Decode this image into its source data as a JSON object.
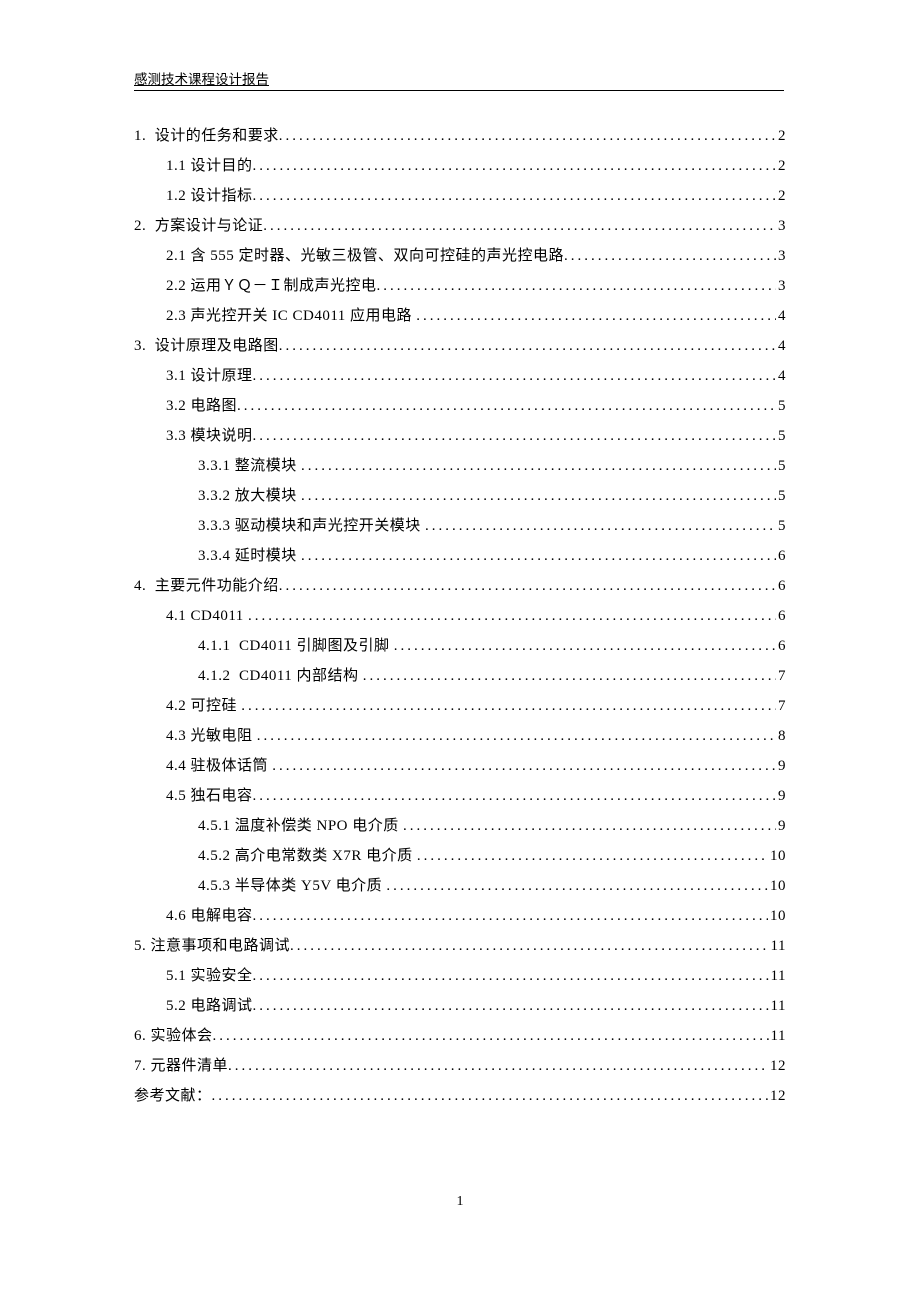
{
  "header": "感测技术课程设计报告",
  "footerPage": "1",
  "toc": [
    {
      "indent": 0,
      "label": "1.  设计的任务和要求",
      "page": "2"
    },
    {
      "indent": 1,
      "label": "1.1 设计目的",
      "page": "2"
    },
    {
      "indent": 1,
      "label": "1.2 设计指标",
      "page": "2"
    },
    {
      "indent": 0,
      "label": "2.  方案设计与论证",
      "page": "3"
    },
    {
      "indent": 1,
      "label": "2.1 含 555 定时器、光敏三极管、双向可控硅的声光控电路",
      "page": "3"
    },
    {
      "indent": 1,
      "label": "2.2 运用ＹＱ－Ｉ制成声光控电",
      "page": "3"
    },
    {
      "indent": 1,
      "label": "2.3 声光控开关 IC CD4011 应用电路 ",
      "page": "4"
    },
    {
      "indent": 0,
      "label": "3.  设计原理及电路图",
      "page": "4"
    },
    {
      "indent": 1,
      "label": "3.1 设计原理",
      "page": "4"
    },
    {
      "indent": 1,
      "label": "3.2 电路图",
      "page": "5"
    },
    {
      "indent": 1,
      "label": "3.3 模块说明",
      "page": "5"
    },
    {
      "indent": 2,
      "label": "3.3.1 整流模块 ",
      "page": "5"
    },
    {
      "indent": 2,
      "label": "3.3.2 放大模块 ",
      "page": "5"
    },
    {
      "indent": 2,
      "label": "3.3.3 驱动模块和声光控开关模块 ",
      "page": "5"
    },
    {
      "indent": 2,
      "label": "3.3.4 延时模块 ",
      "page": "6"
    },
    {
      "indent": 0,
      "label": "4.  主要元件功能介绍",
      "page": "6"
    },
    {
      "indent": 1,
      "label": "4.1 CD4011 ",
      "page": "6"
    },
    {
      "indent": 2,
      "label": "4.1.1  CD4011 引脚图及引脚 ",
      "page": "6"
    },
    {
      "indent": 2,
      "label": "4.1.2  CD4011 内部结构 ",
      "page": "7"
    },
    {
      "indent": 1,
      "label": "4.2 可控硅 ",
      "page": "7"
    },
    {
      "indent": 1,
      "label": "4.3 光敏电阻 ",
      "page": "8"
    },
    {
      "indent": 1,
      "label": "4.4 驻极体话筒 ",
      "page": "9"
    },
    {
      "indent": 1,
      "label": "4.5 独石电容",
      "page": "9"
    },
    {
      "indent": 2,
      "label": "4.5.1 温度补偿类 NPO 电介质 ",
      "page": "9"
    },
    {
      "indent": 2,
      "label": "4.5.2 高介电常数类 X7R 电介质 ",
      "page": "10"
    },
    {
      "indent": 2,
      "label": "4.5.3 半导体类 Y5V 电介质 ",
      "page": "10"
    },
    {
      "indent": 1,
      "label": "4.6 电解电容",
      "page": "10"
    },
    {
      "indent": 0,
      "label": "5. 注意事项和电路调试",
      "page": "11"
    },
    {
      "indent": 1,
      "label": "5.1 实验安全",
      "page": "11"
    },
    {
      "indent": 1,
      "label": "5.2 电路调试",
      "page": "11"
    },
    {
      "indent": 0,
      "label": "6. 实验体会",
      "page": "11"
    },
    {
      "indent": 0,
      "label": "7. 元器件清单",
      "page": "12"
    },
    {
      "indent": 0,
      "label": "参考文献：",
      "page": "12"
    }
  ]
}
